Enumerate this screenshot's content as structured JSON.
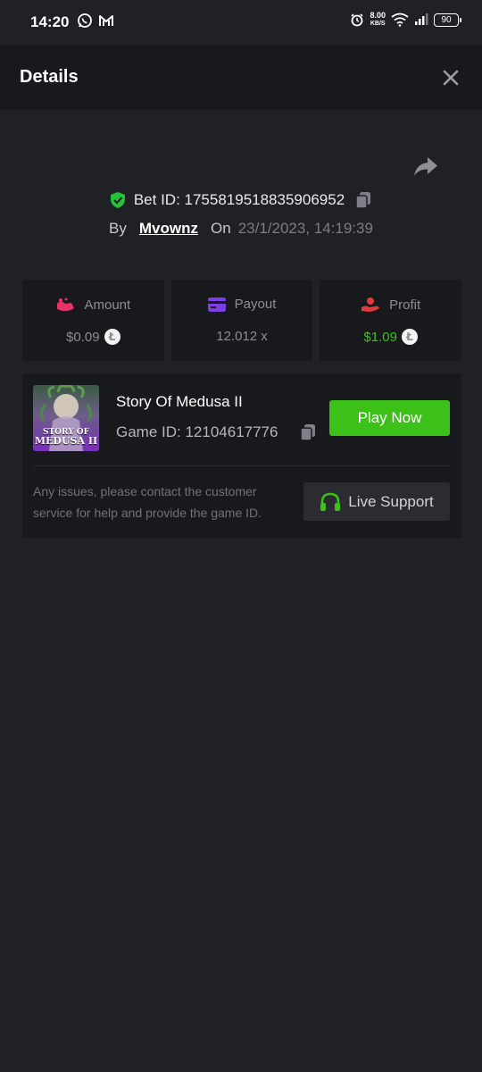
{
  "status_bar": {
    "time": "14:20",
    "speed_value": "8.00",
    "speed_unit": "KB/S",
    "battery": "90"
  },
  "header": {
    "title": "Details"
  },
  "bet": {
    "bet_id_label": "Bet ID: 1755819518835906952",
    "by_label": "By",
    "username": "Mvownz",
    "on_label": "On",
    "datetime": "23/1/2023, 14:19:39"
  },
  "stats": [
    {
      "label": "Amount",
      "value": "$0.09",
      "icon": "wallet-icon",
      "icon_color": "#e8336a",
      "value_color": "#8b8e95"
    },
    {
      "label": "Payout",
      "value": "12.012 x",
      "icon": "card-icon",
      "icon_color": "#7b3fe4",
      "value_color": "#8b8e95"
    },
    {
      "label": "Profit",
      "value": "$1.09",
      "icon": "hand-coin-icon",
      "icon_color": "#e23b3b",
      "value_color": "#3bc117"
    }
  ],
  "game": {
    "name": "Story Of Medusa II",
    "game_id_label": "Game ID: 12104617776",
    "thumb_text_line1": "STORY OF",
    "thumb_text_line2": "MEDUSA II",
    "play_label": "Play Now",
    "notice": "Any issues, please contact the customer service for help and provide the game ID.",
    "support_label": "Live Support"
  },
  "colors": {
    "accent_green": "#3bc117",
    "shield_green": "#24c13a",
    "background": "#202125",
    "card": "#18191d"
  }
}
